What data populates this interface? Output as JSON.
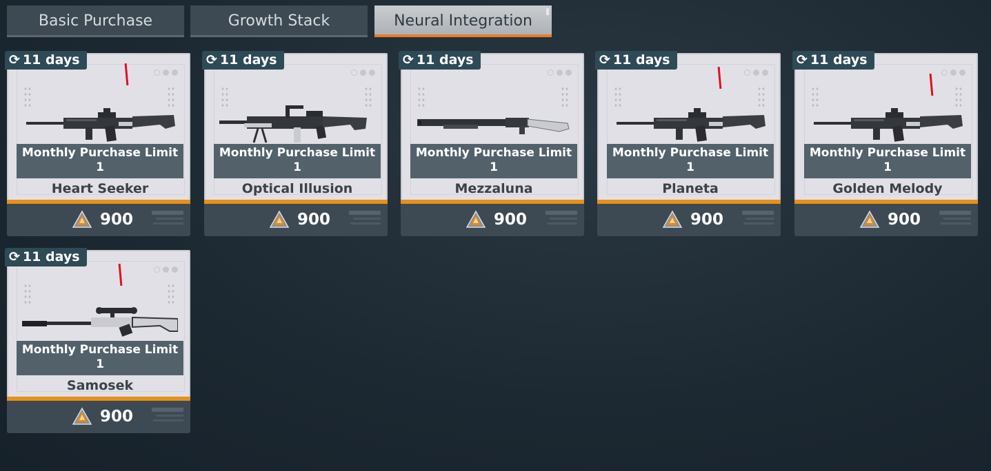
{
  "tabs": [
    {
      "label": "Basic Purchase",
      "active": false
    },
    {
      "label": "Growth Stack",
      "active": false
    },
    {
      "label": "Neural Integration",
      "active": true
    }
  ],
  "colors": {
    "accent": "#e8901a",
    "tab_active_underline": "#e87d2a",
    "marker": "#e01020"
  },
  "common": {
    "refresh_icon": "refresh-icon",
    "limit_label": "Monthly Purchase Limit",
    "limit_value": "1",
    "currency_icon": "currency-icon"
  },
  "cards": [
    {
      "name": "Heart Seeker",
      "timer": "11 days",
      "price": "900",
      "weapon": "assault-rifle"
    },
    {
      "name": "Optical Illusion",
      "timer": "11 days",
      "price": "900",
      "weapon": "machine-gun"
    },
    {
      "name": "Mezzaluna",
      "timer": "11 days",
      "price": "900",
      "weapon": "shotgun"
    },
    {
      "name": "Planeta",
      "timer": "11 days",
      "price": "900",
      "weapon": "assault-rifle"
    },
    {
      "name": "Golden Melody",
      "timer": "11 days",
      "price": "900",
      "weapon": "assault-rifle"
    },
    {
      "name": "Samosek",
      "timer": "11 days",
      "price": "900",
      "weapon": "sniper-rifle"
    }
  ]
}
